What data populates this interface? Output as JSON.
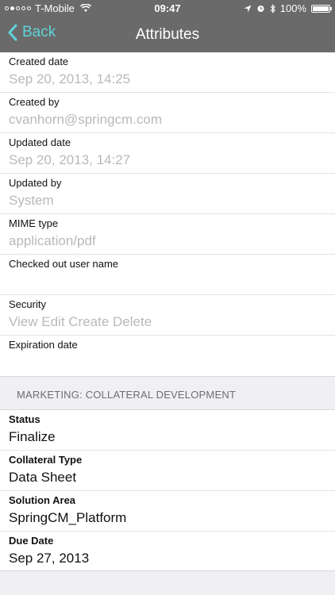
{
  "status_bar": {
    "carrier": "T-Mobile",
    "time": "09:47",
    "battery": "100%",
    "battery_level": 1.0
  },
  "nav": {
    "back_label": "Back",
    "title": "Attributes"
  },
  "attributes": [
    {
      "label": "Created date",
      "value": "Sep 20, 2013, 14:25"
    },
    {
      "label": "Created by",
      "value": "cvanhorn@springcm.com"
    },
    {
      "label": "Updated date",
      "value": "Sep 20, 2013, 14:27"
    },
    {
      "label": "Updated by",
      "value": "System"
    },
    {
      "label": "MIME type",
      "value": "application/pdf"
    },
    {
      "label": "Checked out user name",
      "value": ""
    },
    {
      "label": "Security",
      "value": "View Edit Create Delete"
    },
    {
      "label": "Expiration date",
      "value": ""
    }
  ],
  "section": {
    "header": "MARKETING: COLLATERAL DEVELOPMENT",
    "fields": [
      {
        "label": "Status",
        "value": "Finalize"
      },
      {
        "label": "Collateral Type",
        "value": "Data Sheet"
      },
      {
        "label": "Solution Area",
        "value": "SpringCM_Platform"
      },
      {
        "label": "Due Date",
        "value": "Sep 27, 2013"
      }
    ]
  },
  "colors": {
    "bar_bg": "#6a6a6a",
    "accent": "#5fd3d8",
    "placeholder_text": "#b9b9b9",
    "section_bg": "#efeff4"
  },
  "icons": [
    "signal-dots-icon",
    "wifi-icon",
    "location-icon",
    "alarm-icon",
    "bluetooth-icon",
    "battery-icon",
    "chevron-left-icon"
  ]
}
